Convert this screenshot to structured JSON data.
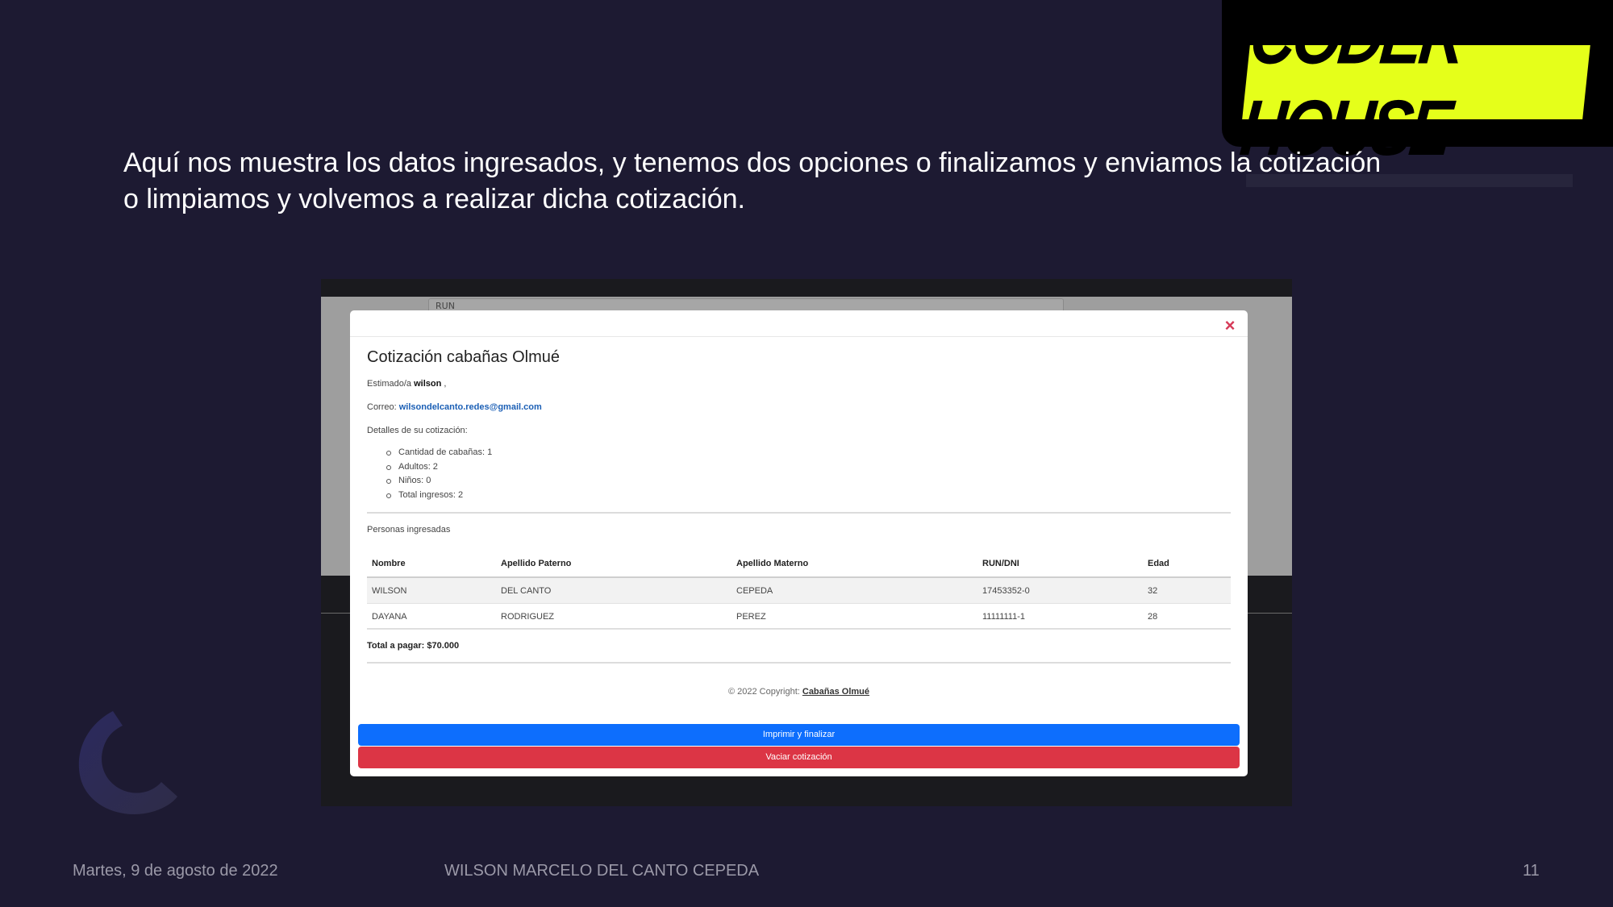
{
  "logo": {
    "text": "CODER HOUSE"
  },
  "slide": {
    "text_line1": "Aquí nos muestra los datos ingresados, y tenemos dos opciones o finalizamos y enviamos la cotización",
    "text_line2": "o limpiamos y volvemos a realizar dicha cotización."
  },
  "background_form": {
    "run_label": "RUN"
  },
  "modal": {
    "title": "Cotización cabañas Olmué",
    "greeting_prefix": "Estimado/a",
    "greeting_name": "wilson",
    "greeting_suffix": ",",
    "email_label": "Correo:",
    "email": "wilsondelcanto.redes@gmail.com",
    "details_label": "Detalles de su cotización:",
    "details": [
      "Cantidad de cabañas: 1",
      "Adultos: 2",
      "Niños: 0",
      "Total ingresos: 2"
    ],
    "persons_label": "Personas ingresadas",
    "table": {
      "headers": [
        "Nombre",
        "Apellido Paterno",
        "Apellido Materno",
        "RUN/DNI",
        "Edad"
      ],
      "rows": [
        [
          "WILSON",
          "DEL CANTO",
          "CEPEDA",
          "17453352-0",
          "32"
        ],
        [
          "DAYANA",
          "RODRIGUEZ",
          "PEREZ",
          "11111111-1",
          "28"
        ]
      ]
    },
    "total": "Total a pagar: $70.000",
    "copyright_text": "© 2022 Copyright:",
    "copyright_link": "Cabañas Olmué",
    "btn_print": "Imprimir y finalizar",
    "btn_clear": "Vaciar cotización"
  },
  "footer": {
    "date": "Martes, 9 de agosto de 2022",
    "author": "WILSON MARCELO DEL CANTO CEPEDA",
    "page": "11"
  },
  "colors": {
    "background": "#1d1a32",
    "logo_yellow": "#e5ff1a",
    "primary": "#0d6efd",
    "danger": "#dc3545",
    "close": "#d63a58"
  }
}
